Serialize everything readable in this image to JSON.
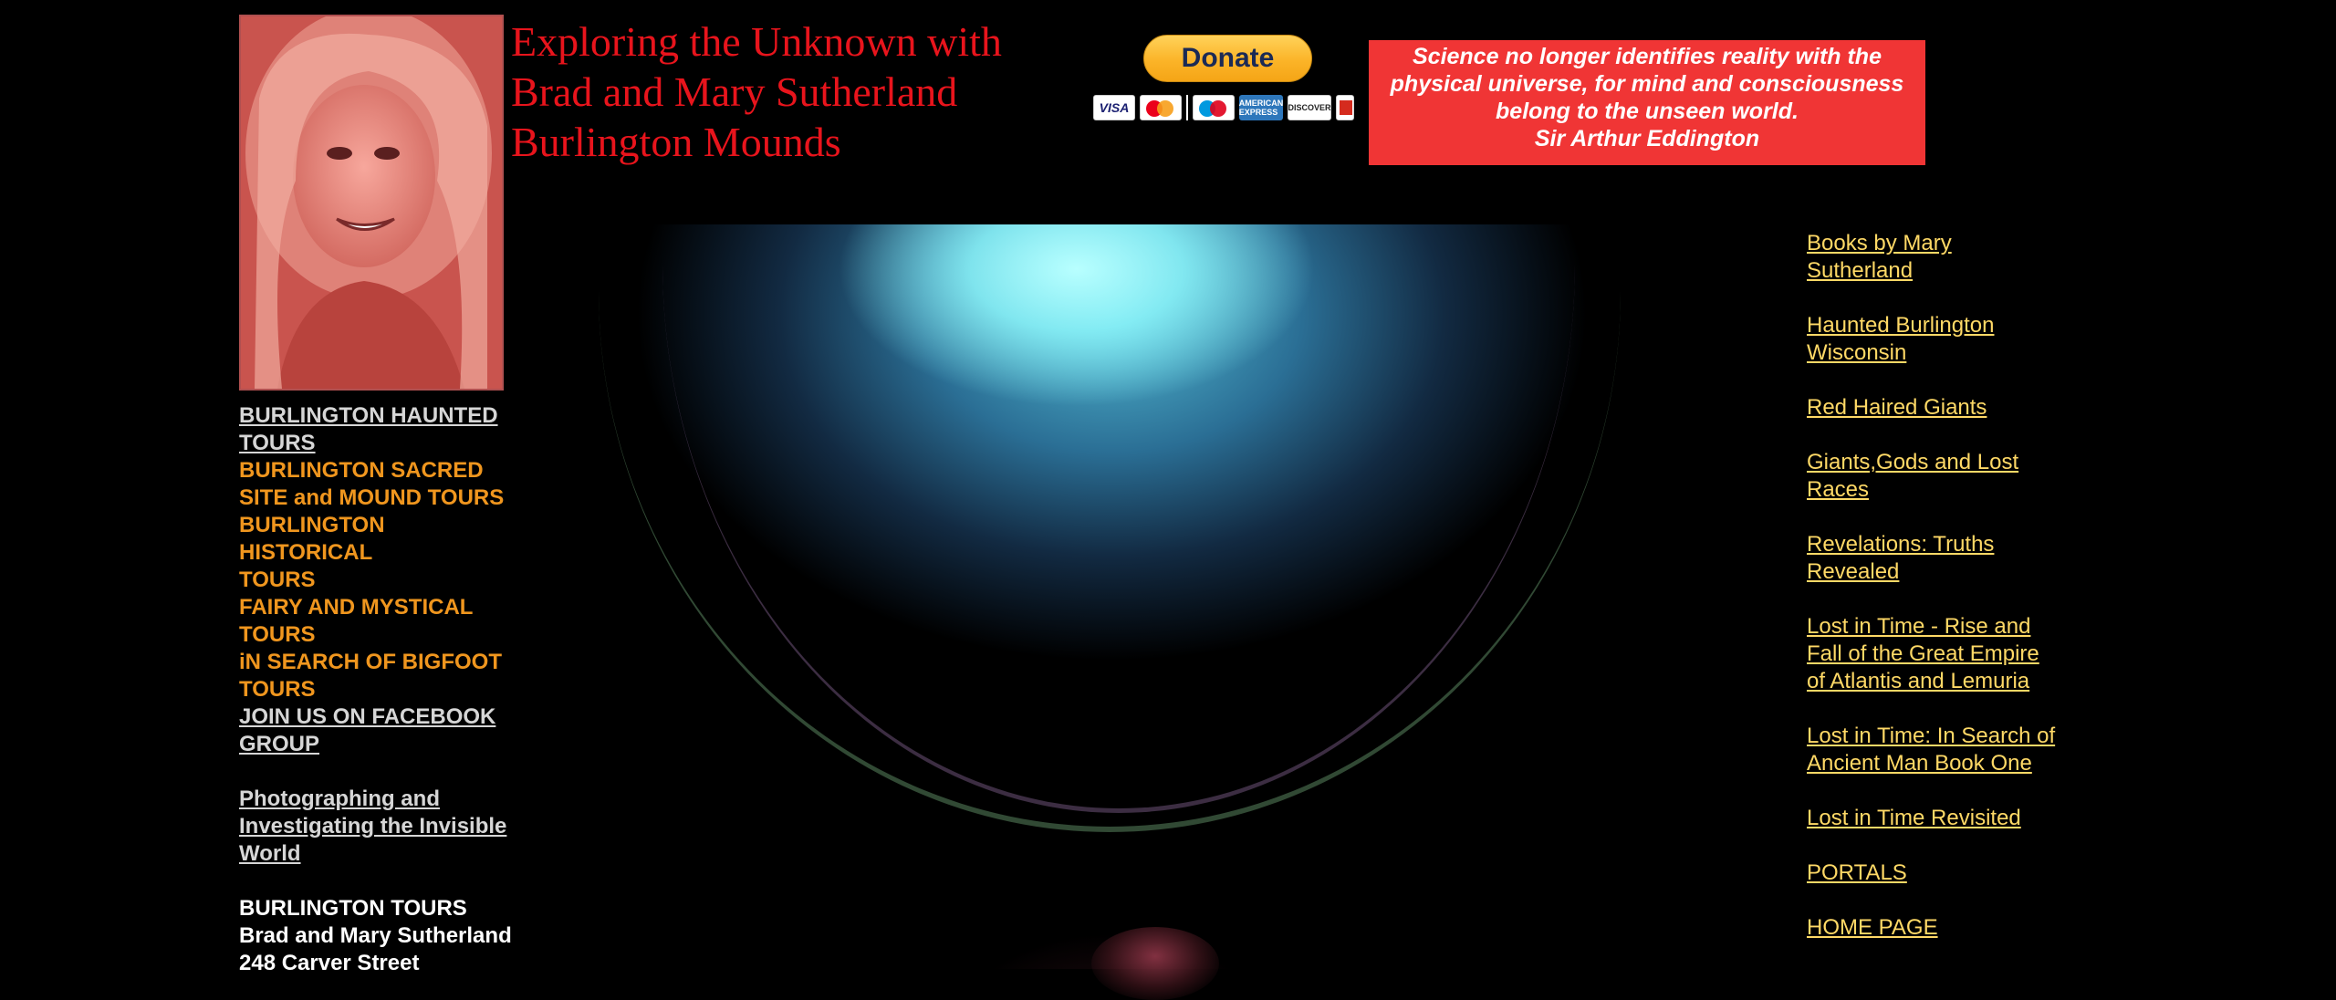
{
  "header": {
    "title_lines": [
      "Exploring the Unknown with",
      "Brad and Mary Sutherland",
      "Burlington Mounds"
    ]
  },
  "donate": {
    "button_label": "Donate",
    "cards": [
      "VISA",
      "AMERICAN EXPRESS",
      "DISCOVER"
    ]
  },
  "quote": {
    "text": "Science no longer identifies reality with the physical universe, for mind and consciousness belong to the unseen world.",
    "author": "Sir Arthur Eddington"
  },
  "left_nav": {
    "items": [
      {
        "label": "BURLINGTON HAUNTED TOURS"
      },
      {
        "label": "BURLINGTON SACRED SITE  and MOUND TOURS"
      },
      {
        "label": "BURLINGTON HISTORICAL TOURS"
      },
      {
        "label": "FAIRY AND MYSTICAL TOURS"
      },
      {
        "label": "iN SEARCH OF BIGFOOT TOURS"
      },
      {
        "label": "JOIN US ON FACEBOOK GROUP"
      },
      {
        "label": "Photographing and Investigating the Invisible World"
      }
    ],
    "address": {
      "line1": "BURLINGTON TOURS",
      "line2": "Brad and Mary Sutherland",
      "line3": "248 Carver Street"
    }
  },
  "right_nav": {
    "items": [
      {
        "label": "Books by Mary Sutherland"
      },
      {
        "label": "Haunted Burlington Wisconsin"
      },
      {
        "label": "Red Haired Giants"
      },
      {
        "label": "Giants,Gods and Lost Races"
      },
      {
        "label": "Revelations: Truths Revealed"
      },
      {
        "label": "Lost in Time - Rise and Fall of the Great Empire of Atlantis and Lemuria"
      },
      {
        "label": "Lost in Time: In Search of Ancient Man  Book One"
      },
      {
        "label": "Lost in Time Revisited"
      },
      {
        "label": "PORTALS"
      },
      {
        "label": "HOME PAGE"
      }
    ]
  },
  "colors": {
    "title": "#e8141c",
    "quote_bg": "#f03535",
    "nav_orange": "#f0961e",
    "nav_gray": "#d6d6d6",
    "right_links": "#ffd966"
  }
}
